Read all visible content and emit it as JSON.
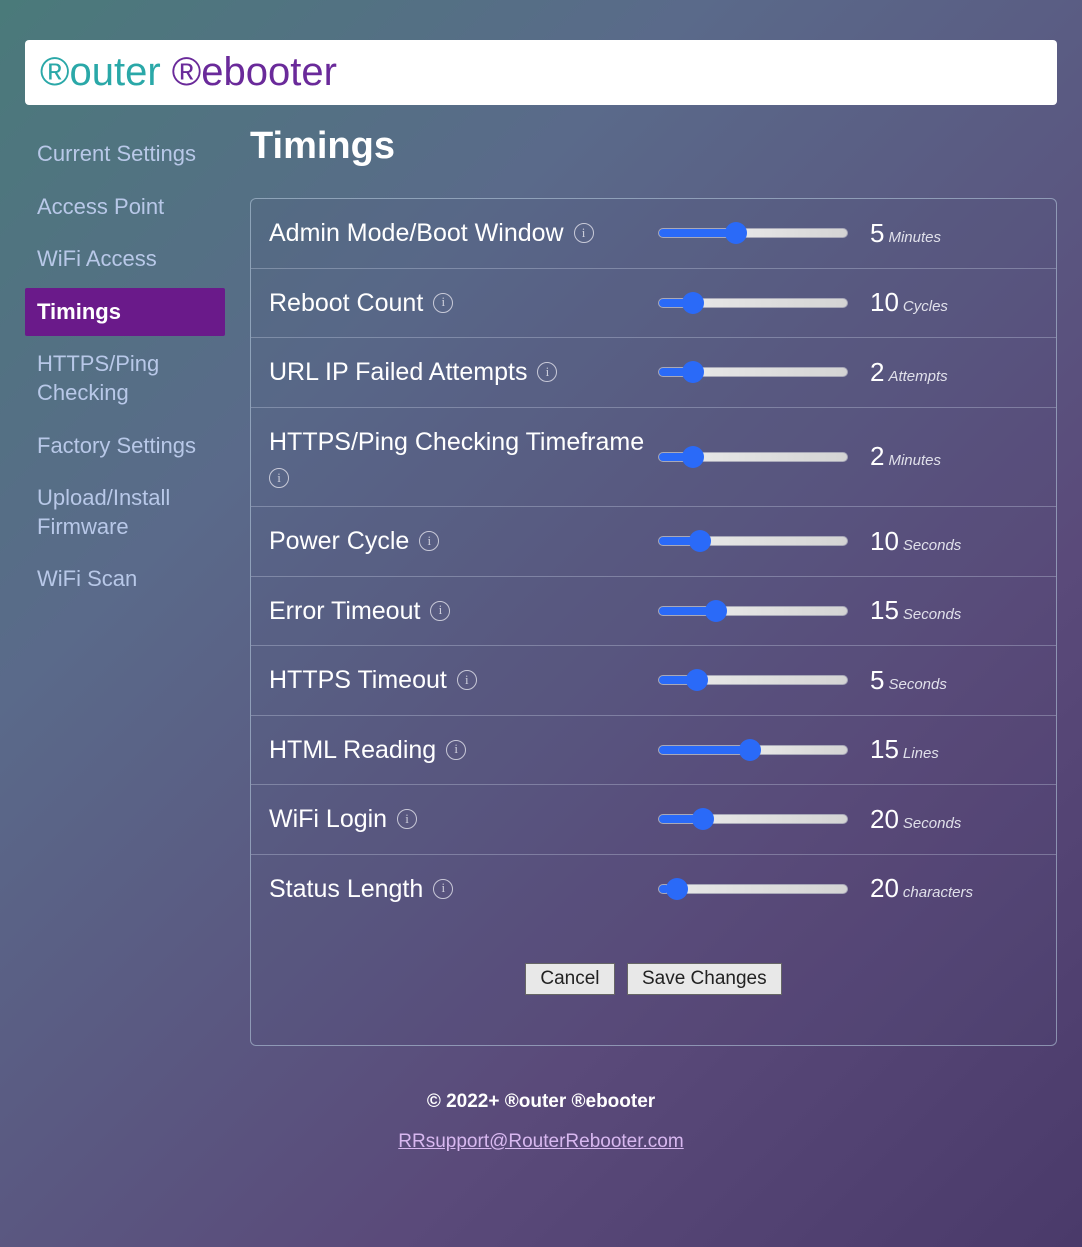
{
  "brand": {
    "r1": "®",
    "rest1": "outer",
    "space": " ",
    "r2": "®",
    "rest2": "ebooter"
  },
  "sidebar": {
    "items": [
      {
        "label": "Current Settings",
        "active": false
      },
      {
        "label": "Access Point",
        "active": false
      },
      {
        "label": "WiFi Access",
        "active": false
      },
      {
        "label": "Timings",
        "active": true
      },
      {
        "label": "HTTPS/Ping Checking",
        "active": false
      },
      {
        "label": "Factory Settings",
        "active": false
      },
      {
        "label": "Upload/Install Firmware",
        "active": false
      },
      {
        "label": "WiFi Scan",
        "active": false
      }
    ]
  },
  "page": {
    "title": "Timings"
  },
  "settings": [
    {
      "label": "Admin Mode/Boot Window",
      "value": 5,
      "unit": "Minutes",
      "min": 0,
      "max": 12,
      "pct": 40
    },
    {
      "label": "Reboot Count",
      "value": 10,
      "unit": "Cycles",
      "min": 0,
      "max": 100,
      "pct": 14
    },
    {
      "label": "URL IP Failed Attempts",
      "value": 2,
      "unit": "Attempts",
      "min": 0,
      "max": 20,
      "pct": 14
    },
    {
      "label": "HTTPS/Ping Checking Timeframe",
      "value": 2,
      "unit": "Minutes",
      "min": 0,
      "max": 20,
      "pct": 14
    },
    {
      "label": "Power Cycle",
      "value": 10,
      "unit": "Seconds",
      "min": 0,
      "max": 60,
      "pct": 18
    },
    {
      "label": "Error Timeout",
      "value": 15,
      "unit": "Seconds",
      "min": 0,
      "max": 60,
      "pct": 28
    },
    {
      "label": "HTTPS Timeout",
      "value": 5,
      "unit": "Seconds",
      "min": 0,
      "max": 60,
      "pct": 16
    },
    {
      "label": "HTML Reading",
      "value": 15,
      "unit": "Lines",
      "min": 0,
      "max": 30,
      "pct": 48
    },
    {
      "label": "WiFi Login",
      "value": 20,
      "unit": "Seconds",
      "min": 0,
      "max": 120,
      "pct": 20
    },
    {
      "label": "Status Length",
      "value": 20,
      "unit": "characters",
      "min": 0,
      "max": 500,
      "pct": 4
    }
  ],
  "actions": {
    "cancel": "Cancel",
    "save": "Save Changes"
  },
  "footer": {
    "copyright": "© 2022+ ®outer ®ebooter",
    "support": "RRsupport@RouterRebooter.com"
  }
}
